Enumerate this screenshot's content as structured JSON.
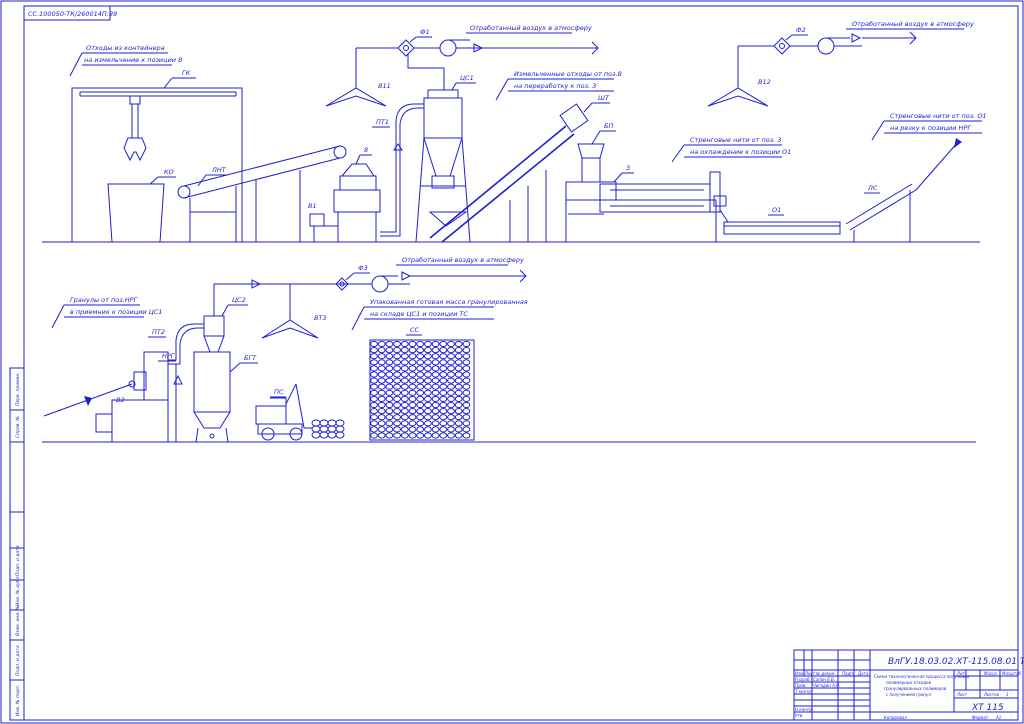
{
  "stamp": "СС.100050-ТК/260014П.89",
  "top_row": {
    "note_waste": [
      "Отходы из контейнера",
      "на измельчение к позиции 8"
    ],
    "tag_gk": "ГК",
    "tag_ko": "КО",
    "tag_lnt": "ЛНТ",
    "tag_8": "8",
    "tag_v1": "В1",
    "tag_pt1": "ПТ1",
    "tag_ts1": "ЦС1",
    "tag_f1": "Ф1",
    "tag_v11": "В11",
    "note_air1": "Отработанный воздух в атмосферу",
    "note_crushed": [
      "Измельченные отходы от поз.8",
      "на переработку к поз. 3"
    ],
    "tag_sht": "ШТ",
    "tag_bp": "БП",
    "tag_3": "3",
    "note_strand": [
      "Стренговые нити от поз. 3",
      "на охлаждение к позиции О1"
    ],
    "tag_o1": "О1",
    "tag_f2": "Ф2",
    "tag_v12": "В12",
    "note_air2": "Отработанный воздух в атмосферу",
    "note_gran": [
      "Стренговые нити от поз. О1",
      "на резку к позиции НРГ"
    ],
    "tag_ls": "ЛС"
  },
  "bottom_row": {
    "note_granule": [
      "Гранулы от поз.НРГ",
      "в приемник к позиции ЦС1"
    ],
    "tag_v2": "В2",
    "tag_nrg": "НРГ",
    "tag_pt2": "ПТ2",
    "tag_ts2": "ЦС2",
    "tag_bgt": "БГТ",
    "tag_pc": "ПС",
    "tag_f3": "Ф3",
    "tag_vt3": "ВТ3",
    "note_air3": "Отработанный воздух в атмосферу",
    "note_bags": [
      "Упакованная готовая масса гранулированная",
      "на складе ЦС1 и позиции ТС"
    ],
    "tag_ss": "СС"
  },
  "side_columns": [
    "Подп. и дата",
    "Взам. инв. №",
    "Инв. № дубл.",
    "Подп. и дата",
    "Инв. № подл.",
    "Справ. №",
    "Перв. примен."
  ],
  "title_block": {
    "doc_code": "ВлГУ.18.03.02.ХТ-115.08.01 ТЗ",
    "description": [
      "Схема технологическая процесса получения",
      "полимерных отходов",
      "гранулированных полимеров",
      "с получением гранул"
    ],
    "rows": [
      "Изм.",
      "Лист",
      "№ докум.",
      "Подп.",
      "Дата",
      "Разраб.",
      "Пров.",
      "Т.контр.",
      "Н.контр.",
      "Утв."
    ],
    "names": [
      "Сапон Е.В.",
      "Чигодин А.Н."
    ],
    "lit": "Лит.",
    "mass": "Масса",
    "scale": "Масштаб",
    "sheet": "Лист",
    "sheets": "Листов",
    "sheets_val": "1",
    "group": "ХТ 115",
    "copied": "Копировал",
    "format": "Формат",
    "format_val": "А1"
  }
}
